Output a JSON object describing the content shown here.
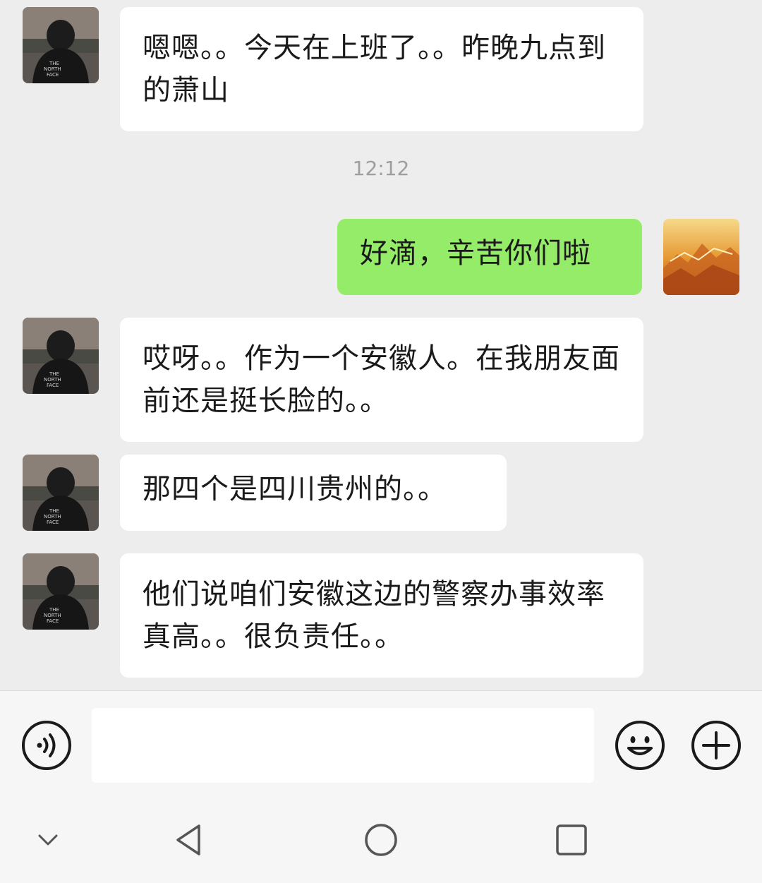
{
  "chat": {
    "messages": [
      {
        "from": "contact",
        "text": "嗯嗯。。今天在上班了。。昨晚九点到的萧山"
      },
      {
        "type": "time",
        "text": "12:12"
      },
      {
        "from": "me",
        "text": "好滴，辛苦你们啦"
      },
      {
        "from": "contact",
        "text": "哎呀。。作为一个安徽人。在我朋友面前还是挺长脸的。。"
      },
      {
        "from": "contact",
        "text": "那四个是四川贵州的。。"
      },
      {
        "from": "contact",
        "text": "他们说咱们安徽这边的警察办事效率真高。。很负责任。。"
      }
    ]
  },
  "input_bar": {
    "voice_icon": "voice-icon",
    "emoji_icon": "emoji-icon",
    "plus_icon": "plus-icon",
    "input_value": ""
  },
  "nav_bar": {
    "collapse_icon": "chevron-down-icon",
    "back_icon": "back-triangle-icon",
    "home_icon": "home-circle-icon",
    "recents_icon": "recents-square-icon"
  },
  "colors": {
    "background": "#ededed",
    "incoming_bubble": "#ffffff",
    "outgoing_bubble": "#95ec69",
    "timestamp": "#9e9e9e"
  }
}
